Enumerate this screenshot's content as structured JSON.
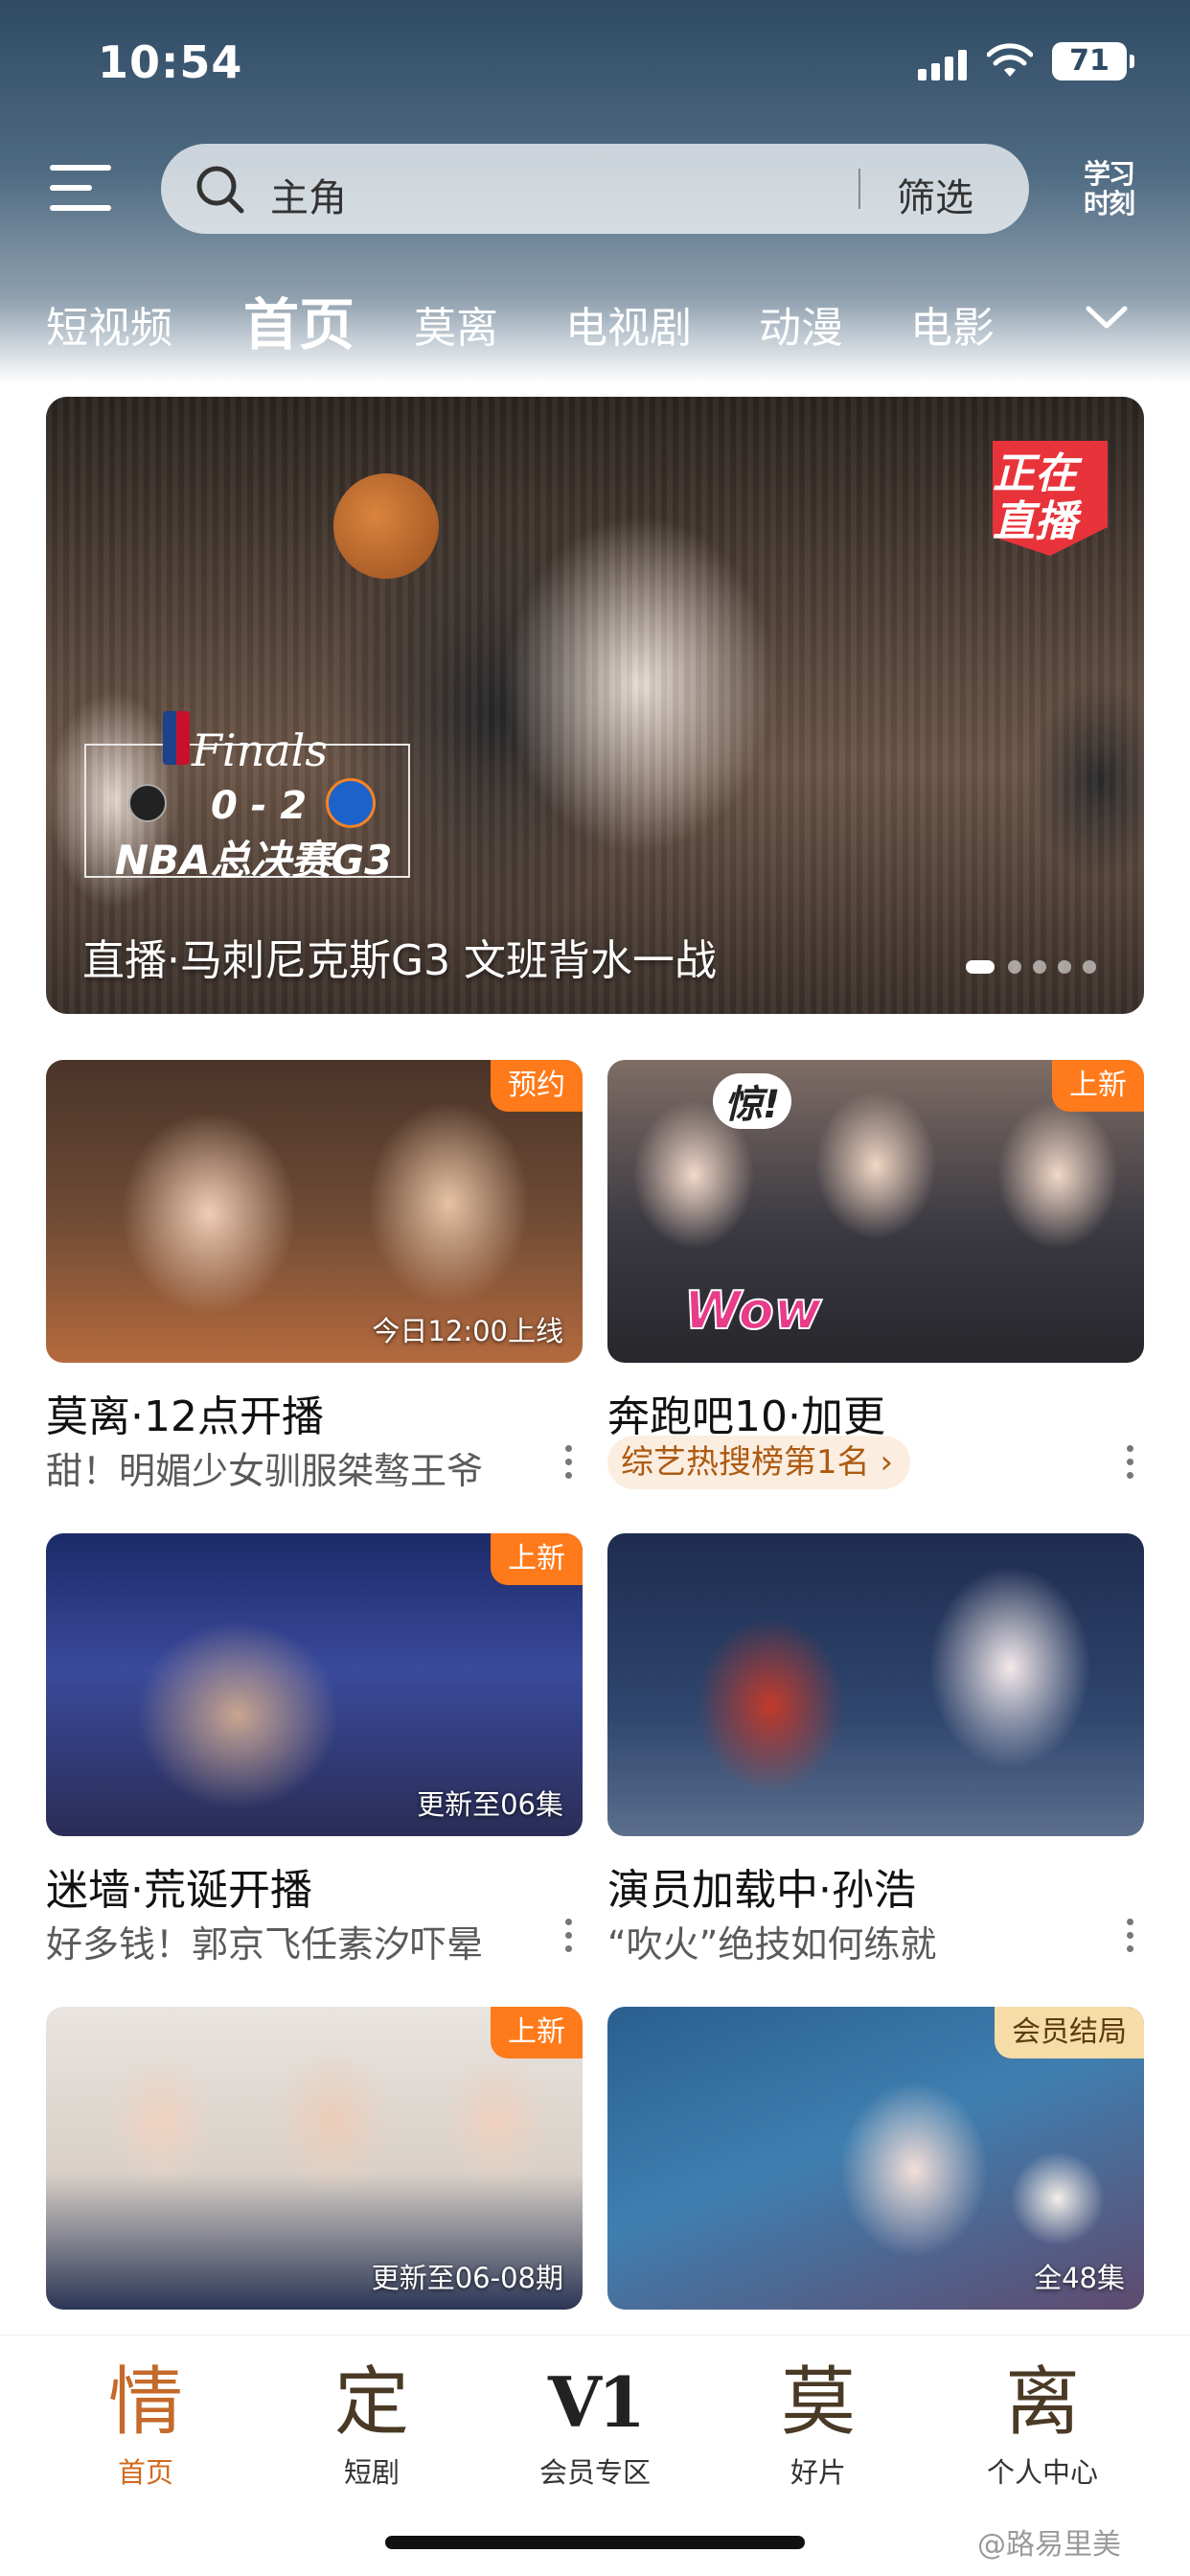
{
  "status_bar": {
    "time": "10:54",
    "battery": "71"
  },
  "header": {
    "search_placeholder": "主角",
    "filter_label": "筛选",
    "study_line1": "学习",
    "study_line2": "时刻",
    "tabs": [
      {
        "label": "短视频",
        "active": false
      },
      {
        "label": "首页",
        "active": true
      },
      {
        "label": "莫离",
        "active": false
      },
      {
        "label": "电视剧",
        "active": false
      },
      {
        "label": "动漫",
        "active": false
      },
      {
        "label": "电影",
        "active": false
      }
    ]
  },
  "hero": {
    "live_line1": "正在",
    "live_line2": "直播",
    "finals_title": "Finals",
    "finals_score": "0 - 2",
    "finals_game": "NBA总决赛G3",
    "caption": "直播·马刺尼克斯G3 文班背水一战",
    "slide_count": 5,
    "active_slide": 1
  },
  "cards": [
    {
      "title": "莫离·12点开播",
      "subtitle": "甜！明媚少女驯服桀骜王爷",
      "badge": "预约",
      "badge_style": "orange",
      "episode": "今日12:00上线"
    },
    {
      "title": "奔跑吧10·加更",
      "chip": "综艺热搜榜第1名 ›",
      "badge": "上新",
      "badge_style": "orange",
      "overlay_1": "惊!",
      "overlay_2": "Wow"
    },
    {
      "title": "迷墙·荒诞开播",
      "subtitle": "好多钱！郭京飞任素汐吓晕",
      "badge": "上新",
      "badge_style": "orange",
      "episode": "更新至06集"
    },
    {
      "title": "演员加载中·孙浩",
      "subtitle": "“吹火”绝技如何练就"
    },
    {
      "badge": "上新",
      "badge_style": "orange",
      "episode": "更新至06-08期"
    },
    {
      "badge": "会员结局",
      "badge_style": "vip",
      "episode": "全48集"
    }
  ],
  "bottom_nav": [
    {
      "glyph": "情",
      "label": "首页",
      "active": true
    },
    {
      "glyph": "定",
      "label": "短剧",
      "active": false
    },
    {
      "glyph": "V1",
      "label": "会员专区",
      "active": false
    },
    {
      "glyph": "莫",
      "label": "好片",
      "active": false
    },
    {
      "glyph": "离",
      "label": "个人中心",
      "active": false
    }
  ],
  "watermark": "@路易里美",
  "colors": {
    "accent": "#ff7a1a",
    "active_tab": "#d2691e",
    "vip_badge": "#f6dca7",
    "live_badge": "#e8333a"
  }
}
